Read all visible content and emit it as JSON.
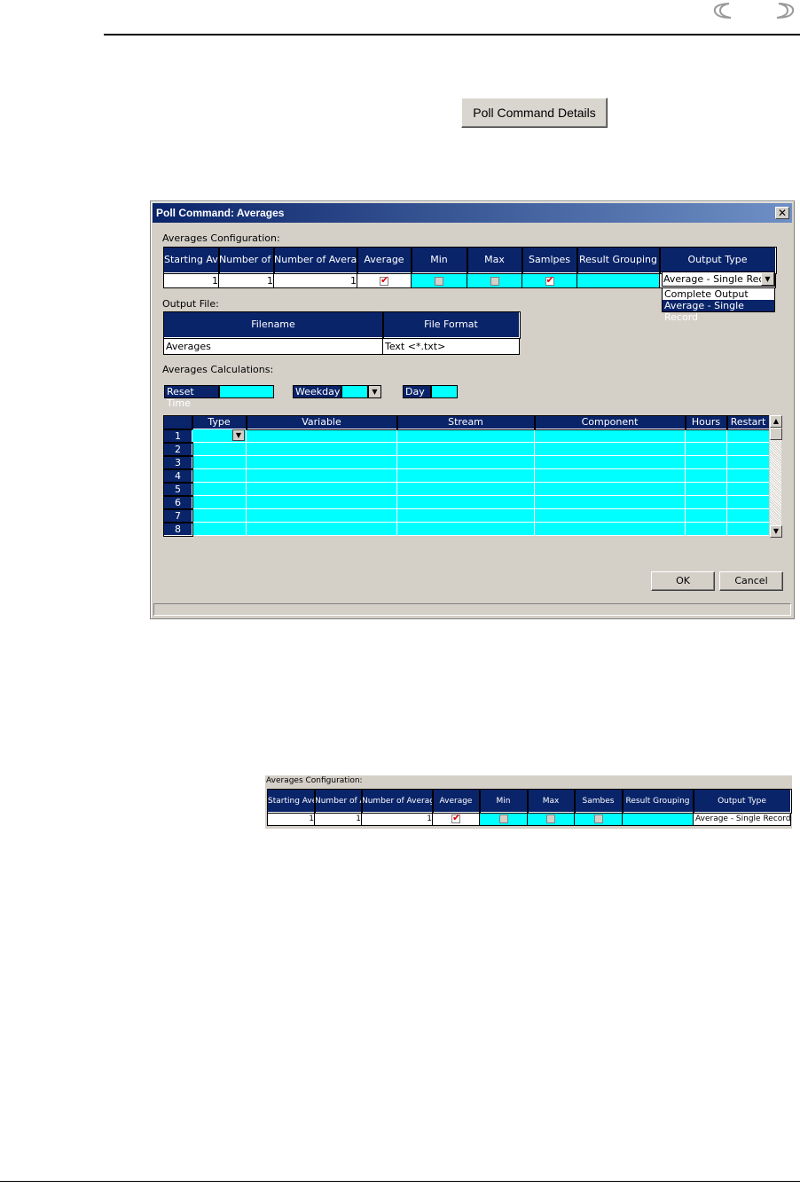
{
  "poll_button": {
    "label": "Poll Command Details"
  },
  "dialog": {
    "title": "Poll Command: Averages",
    "close_label": "x",
    "averages_config": {
      "label": "Averages Configuration:",
      "headers": [
        "Starting Average",
        "Number of Averages",
        "Number of Average Periods",
        "Average",
        "Min",
        "Max",
        "Samlpes",
        "Result Grouping",
        "Output Type"
      ],
      "values": {
        "starting_average": "1",
        "number_of_averages": "1",
        "number_of_average_periods": "1",
        "average_checked": true,
        "min_checked": false,
        "max_checked": false,
        "samples_checked": true,
        "result_grouping": "",
        "output_type": "Average - Single Record"
      },
      "output_type_options": [
        "Complete Output",
        "Average - Single Record"
      ]
    },
    "output_file": {
      "label": "Output File:",
      "headers": [
        "Filename",
        "File Format"
      ],
      "filename": "Averages",
      "file_format": "Text <*.txt>"
    },
    "averages_calculations": {
      "label": "Averages Calculations:",
      "reset_time_label": "Reset Time",
      "weekday_label": "Weekday",
      "day_label": "Day",
      "headers": [
        "Type",
        "Variable",
        "Stream",
        "Component",
        "Hours",
        "Restart"
      ],
      "rows": [
        "1",
        "2",
        "3",
        "4",
        "5",
        "6",
        "7",
        "8"
      ]
    },
    "ok_label": "OK",
    "cancel_label": "Cancel"
  },
  "panel2": {
    "label": "Averages Configuration:",
    "headers": [
      "Starting Average",
      "Number of Averages",
      "Number of Average Periods",
      "Average",
      "Min",
      "Max",
      "Sambes",
      "Result Grouping",
      "Output Type"
    ],
    "values": {
      "starting_average": "1",
      "number_of_averages": "1",
      "number_of_average_periods": "1",
      "average_checked": true,
      "min_checked": false,
      "max_checked": false,
      "samples_checked": false,
      "output_type": "Average - Single Record"
    }
  },
  "colors": {
    "header_navy": "#0a246a",
    "cell_cyan": "#00ffff",
    "dialog_gray": "#d4d0c8",
    "check_red": "#e00000"
  }
}
